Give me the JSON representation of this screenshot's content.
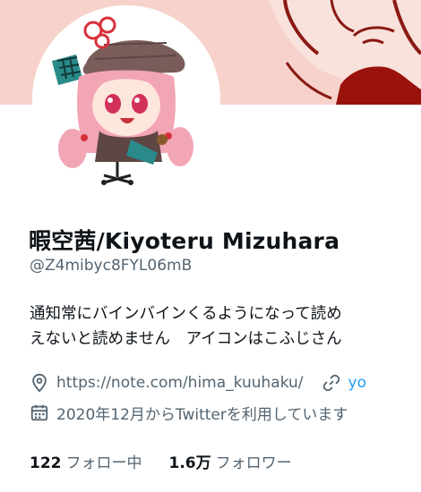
{
  "profile": {
    "display_name": "暇空茜/Kiyoteru Mizuhara",
    "handle": "@Z4mibyc8FYL06mB",
    "bio_lines": [
      "通知常にバインバインくるようになって読め",
      "えないと読めません　アイコンはこふじさん"
    ],
    "website": "https://note.com/hima_kuuhaku/",
    "website2": "yo",
    "joined": "2020年12月からTwitterを利用しています",
    "following_count": "122",
    "following_label": "フォロー中",
    "followers_count": "1.6万",
    "followers_label": "フォロワー"
  },
  "icons": {
    "location": "location-pin-icon",
    "link": "link-icon",
    "calendar": "calendar-icon"
  },
  "colors": {
    "text_primary": "#0f1419",
    "text_secondary": "#536471",
    "link": "#1d9bf0",
    "banner": "#f6d2cb"
  }
}
